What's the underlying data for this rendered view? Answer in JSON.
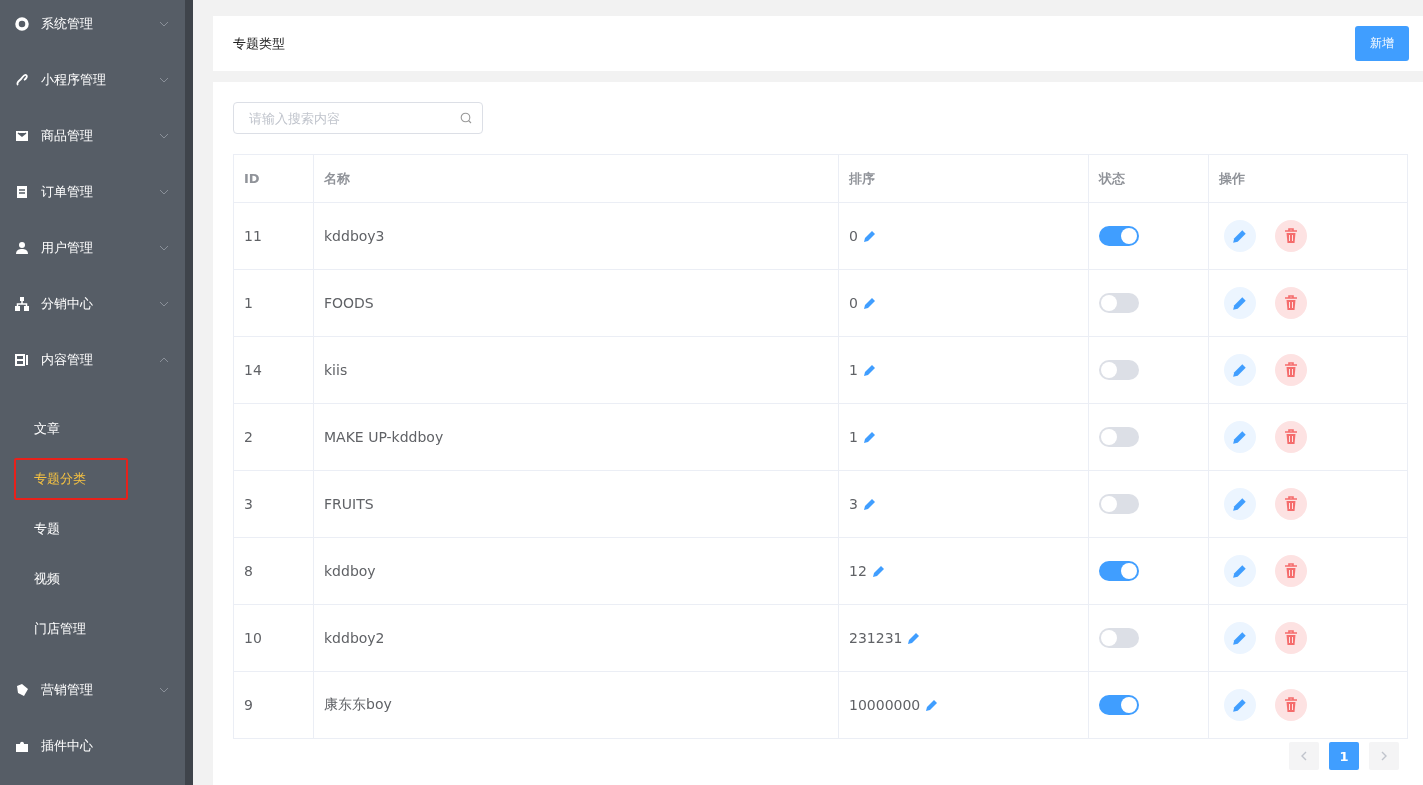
{
  "sidebar": {
    "items": [
      {
        "label": "系统管理",
        "expanded": false
      },
      {
        "label": "小程序管理",
        "expanded": false
      },
      {
        "label": "商品管理",
        "expanded": false
      },
      {
        "label": "订单管理",
        "expanded": false
      },
      {
        "label": "用户管理",
        "expanded": false
      },
      {
        "label": "分销中心",
        "expanded": false
      },
      {
        "label": "内容管理",
        "expanded": true,
        "children": [
          {
            "label": "文章",
            "selected": false
          },
          {
            "label": "专题分类",
            "selected": true
          },
          {
            "label": "专题",
            "selected": false
          },
          {
            "label": "视频",
            "selected": false
          },
          {
            "label": "门店管理",
            "selected": false
          }
        ]
      },
      {
        "label": "营销管理",
        "expanded": false
      },
      {
        "label": "插件中心"
      }
    ]
  },
  "header": {
    "title": "专题类型",
    "add_button": "新增"
  },
  "search": {
    "placeholder": "请输入搜索内容"
  },
  "table": {
    "columns": [
      "ID",
      "名称",
      "排序",
      "状态",
      "操作"
    ],
    "rows": [
      {
        "id": "11",
        "name": "kddboy3",
        "sort": "0",
        "on": true
      },
      {
        "id": "1",
        "name": "FOODS",
        "sort": "0",
        "on": false
      },
      {
        "id": "14",
        "name": "kiis",
        "sort": "1",
        "on": false
      },
      {
        "id": "2",
        "name": "MAKE UP-kddboy",
        "sort": "1",
        "on": false
      },
      {
        "id": "3",
        "name": "FRUITS",
        "sort": "3",
        "on": false
      },
      {
        "id": "8",
        "name": "kddboy",
        "sort": "12",
        "on": true
      },
      {
        "id": "10",
        "name": "kddboy2",
        "sort": "231231",
        "on": false
      },
      {
        "id": "9",
        "name": "康东东boy",
        "sort": "10000000",
        "on": true
      }
    ]
  },
  "pagination": {
    "pages": [
      {
        "label": "1",
        "selected": true
      }
    ]
  }
}
